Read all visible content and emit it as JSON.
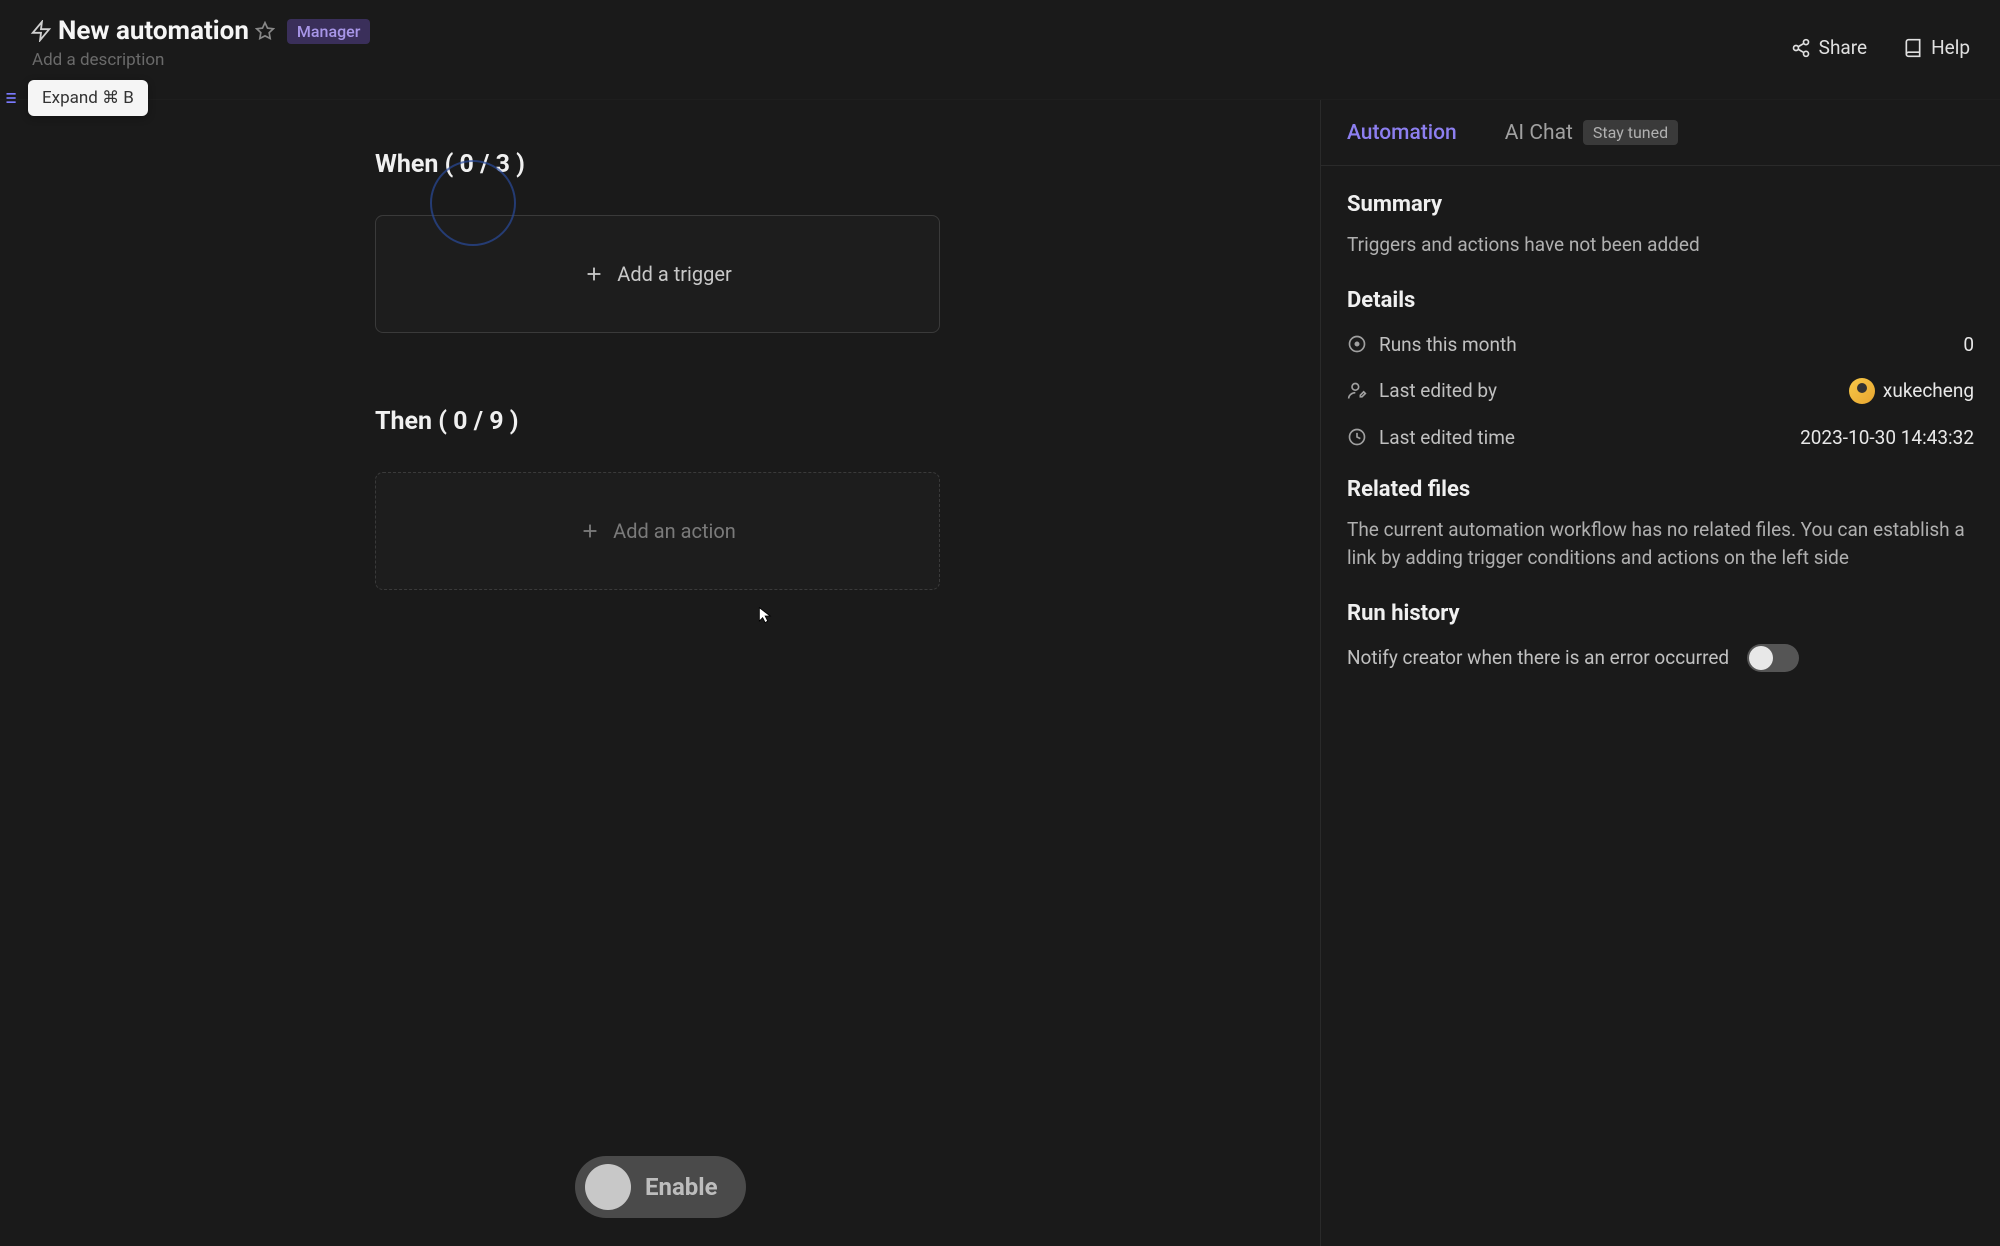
{
  "header": {
    "title": "New automation",
    "role_badge": "Manager",
    "description_placeholder": "Add a description",
    "share_label": "Share",
    "help_label": "Help"
  },
  "tooltip": {
    "expand": "Expand ⌘ B"
  },
  "canvas": {
    "when_title": "When ( 0 / 3 )",
    "add_trigger_label": "Add a trigger",
    "then_title": "Then ( 0 / 9 )",
    "add_action_label": "Add an action",
    "enable_label": "Enable"
  },
  "panel": {
    "tabs": {
      "automation": "Automation",
      "ai_chat": "AI Chat",
      "ai_chat_badge": "Stay tuned"
    },
    "summary": {
      "heading": "Summary",
      "text": "Triggers and actions have not been added"
    },
    "details": {
      "heading": "Details",
      "runs_label": "Runs this month",
      "runs_value": "0",
      "last_edited_by_label": "Last edited by",
      "last_edited_by_value": "xukecheng",
      "last_edited_time_label": "Last edited time",
      "last_edited_time_value": "2023-10-30 14:43:32"
    },
    "related_files": {
      "heading": "Related files",
      "text": "The current automation workflow has no related files. You can establish a link by adding trigger conditions and actions on the left side"
    },
    "run_history": {
      "heading": "Run history",
      "notify_label": "Notify creator when there is an error occurred"
    }
  }
}
